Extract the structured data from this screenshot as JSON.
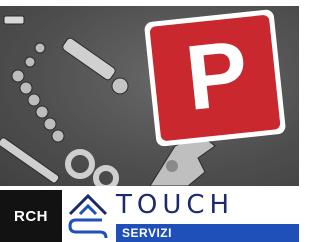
{
  "banner": {
    "brand": "RCH",
    "product": "TOUCH",
    "section": "SERVIZI"
  },
  "photo": {
    "sign_letter": "P"
  },
  "colors": {
    "sign_red": "#c8282e",
    "brand_blue": "#1f4fb8",
    "brand_navy": "#1d2a6b",
    "rch_bg": "#121212"
  }
}
